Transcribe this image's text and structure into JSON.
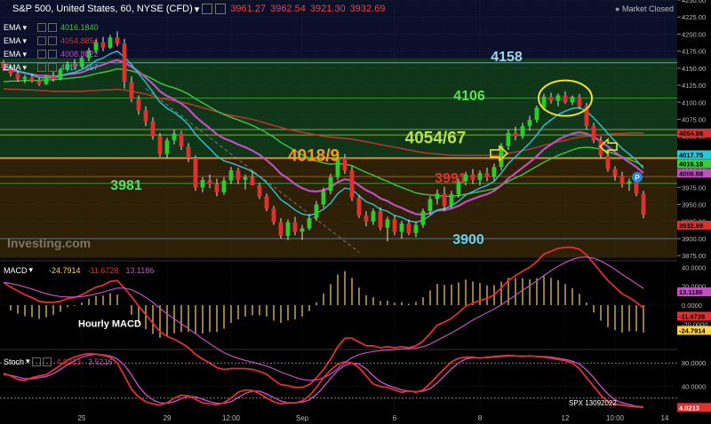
{
  "header": {
    "title": "S&P 500, United States, 60, NYSE (CFD)",
    "ohlc": [
      "3961.27",
      "3962.54",
      "3921.30",
      "3932.69"
    ],
    "status": "Market Closed"
  },
  "ema_legend": [
    {
      "name": "EMA",
      "value": "4016.1840",
      "color": "#3ec83e"
    },
    {
      "name": "EMA",
      "value": "4054.8854",
      "color": "#d23030"
    },
    {
      "name": "EMA",
      "value": "4008.8822",
      "color": "#c050c0"
    },
    {
      "name": "EMA",
      "value": "4017.7467",
      "color": "#29c7d6"
    }
  ],
  "macd_legend": {
    "name": "MACD",
    "values": [
      "-24.7914",
      "-11.6728",
      "13.1186"
    ],
    "colors": [
      "#ffd24a",
      "#e03030",
      "#c050c0"
    ]
  },
  "stoch_legend": {
    "name": "Stoch",
    "values": [
      "4.0213",
      "3.5216"
    ],
    "colors": [
      "#e03030",
      "#c050c0"
    ]
  },
  "watermark": "Investing.com",
  "colors": {
    "up": "#2dcc2d",
    "down": "#e03030",
    "ema_fast": "#29c7d6",
    "ema_mid": "#c050c0",
    "ema_slow": "#3ec83e",
    "ema_long": "#d23030",
    "zone": "#f39c1f",
    "circle": "#f0e020",
    "macd_hist": "#ffd24a",
    "stoch_k": "#e03030",
    "stoch_d": "#c050c0"
  },
  "chart_data": [
    {
      "type": "candlestick",
      "title": "S&P 500, United States, 60, NYSE (CFD)",
      "ylim": [
        3870,
        4250
      ],
      "y_ticks": [
        "3875.00",
        "3900.00",
        "3925.00",
        "3950.00",
        "3975.00",
        "4000.00",
        "4025.00",
        "4050.00",
        "4075.00",
        "4100.00",
        "4125.00",
        "4150.00",
        "4175.00",
        "4200.00",
        "4225.00",
        "4250.00"
      ],
      "x_ticks": [
        {
          "i": 11,
          "label": "25"
        },
        {
          "i": 23,
          "label": "29"
        },
        {
          "i": 32,
          "label": "12:00"
        },
        {
          "i": 42,
          "label": "Sep"
        },
        {
          "i": 55,
          "label": "6"
        },
        {
          "i": 67,
          "label": "8"
        },
        {
          "i": 79,
          "label": "12"
        },
        {
          "i": 86,
          "label": "10:00"
        },
        {
          "i": 93,
          "label": "14"
        }
      ],
      "candles": [
        [
          4158,
          4162,
          4146,
          4150
        ],
        [
          4150,
          4155,
          4138,
          4142
        ],
        [
          4142,
          4147,
          4130,
          4134
        ],
        [
          4134,
          4140,
          4128,
          4137
        ],
        [
          4137,
          4142,
          4129,
          4132
        ],
        [
          4132,
          4136,
          4124,
          4127
        ],
        [
          4127,
          4140,
          4125,
          4138
        ],
        [
          4138,
          4146,
          4130,
          4134
        ],
        [
          4134,
          4150,
          4132,
          4148
        ],
        [
          4148,
          4160,
          4145,
          4156
        ],
        [
          4156,
          4163,
          4148,
          4152
        ],
        [
          4152,
          4168,
          4150,
          4165
        ],
        [
          4165,
          4180,
          4160,
          4176
        ],
        [
          4176,
          4192,
          4172,
          4188
        ],
        [
          4188,
          4196,
          4175,
          4180
        ],
        [
          4180,
          4199,
          4178,
          4195
        ],
        [
          4195,
          4204,
          4182,
          4186
        ],
        [
          4186,
          4193,
          4120,
          4130
        ],
        [
          4130,
          4138,
          4100,
          4105
        ],
        [
          4105,
          4110,
          4082,
          4088
        ],
        [
          4088,
          4094,
          4065,
          4072
        ],
        [
          4072,
          4078,
          4045,
          4050
        ],
        [
          4050,
          4055,
          4020,
          4024
        ],
        [
          4024,
          4048,
          4018,
          4044
        ],
        [
          4044,
          4060,
          4038,
          4054
        ],
        [
          4054,
          4058,
          4030,
          4035
        ],
        [
          4035,
          4040,
          4012,
          4018
        ],
        [
          4018,
          4022,
          3970,
          3975
        ],
        [
          3975,
          3990,
          3968,
          3986
        ],
        [
          3986,
          3994,
          3974,
          3980
        ],
        [
          3980,
          3988,
          3962,
          3968
        ],
        [
          3968,
          3990,
          3964,
          3985
        ],
        [
          3985,
          4005,
          3980,
          4000
        ],
        [
          4000,
          4004,
          3980,
          3986
        ],
        [
          3986,
          3994,
          3972,
          3990
        ],
        [
          3990,
          4000,
          3980,
          3978
        ],
        [
          3978,
          3982,
          3958,
          3962
        ],
        [
          3962,
          3966,
          3940,
          3944
        ],
        [
          3944,
          3948,
          3920,
          3924
        ],
        [
          3924,
          3930,
          3900,
          3904
        ],
        [
          3904,
          3928,
          3898,
          3924
        ],
        [
          3924,
          3932,
          3905,
          3910
        ],
        [
          3910,
          3920,
          3898,
          3915
        ],
        [
          3915,
          3935,
          3912,
          3930
        ],
        [
          3930,
          3955,
          3926,
          3950
        ],
        [
          3950,
          3975,
          3945,
          3970
        ],
        [
          3970,
          3995,
          3965,
          3990
        ],
        [
          3990,
          4022,
          3986,
          4018
        ],
        [
          4018,
          4024,
          3995,
          4000
        ],
        [
          4000,
          4006,
          3955,
          3960
        ],
        [
          3960,
          3964,
          3930,
          3934
        ],
        [
          3934,
          3940,
          3918,
          3925
        ],
        [
          3925,
          3944,
          3920,
          3940
        ],
        [
          3940,
          3946,
          3912,
          3916
        ],
        [
          3916,
          3932,
          3896,
          3928
        ],
        [
          3928,
          3934,
          3905,
          3910
        ],
        [
          3910,
          3926,
          3900,
          3922
        ],
        [
          3922,
          3928,
          3905,
          3908
        ],
        [
          3908,
          3924,
          3902,
          3920
        ],
        [
          3920,
          3944,
          3916,
          3940
        ],
        [
          3940,
          3962,
          3936,
          3958
        ],
        [
          3958,
          3972,
          3950,
          3966
        ],
        [
          3966,
          3976,
          3940,
          3948
        ],
        [
          3948,
          3970,
          3945,
          3965
        ],
        [
          3965,
          3988,
          3960,
          3984
        ],
        [
          3984,
          3998,
          3978,
          3994
        ],
        [
          3994,
          4002,
          3980,
          3986
        ],
        [
          3986,
          4000,
          3978,
          3996
        ],
        [
          3996,
          4004,
          3984,
          3990
        ],
        [
          3990,
          4010,
          3985,
          4005
        ],
        [
          4005,
          4040,
          4000,
          4036
        ],
        [
          4036,
          4060,
          4030,
          4055
        ],
        [
          4055,
          4064,
          4044,
          4050
        ],
        [
          4050,
          4070,
          4046,
          4065
        ],
        [
          4065,
          4080,
          4058,
          4074
        ],
        [
          4074,
          4095,
          4070,
          4092
        ],
        [
          4092,
          4112,
          4088,
          4108
        ],
        [
          4108,
          4114,
          4098,
          4102
        ],
        [
          4102,
          4113,
          4094,
          4110
        ],
        [
          4110,
          4116,
          4098,
          4100
        ],
        [
          4100,
          4110,
          4096,
          4108
        ],
        [
          4108,
          4112,
          4090,
          4094
        ],
        [
          4094,
          4099,
          4060,
          4065
        ],
        [
          4065,
          4070,
          4040,
          4044
        ],
        [
          4044,
          4050,
          4018,
          4022
        ],
        [
          4022,
          4026,
          3998,
          4002
        ],
        [
          4002,
          4006,
          3985,
          3992
        ],
        [
          3992,
          3998,
          3975,
          3980
        ],
        [
          3980,
          3988,
          3970,
          3984
        ],
        [
          3984,
          3990,
          3962,
          3966
        ],
        [
          3966,
          3970,
          3930,
          3935
        ]
      ],
      "ema_fast": [
        4154,
        4150,
        4146,
        4143,
        4140,
        4136,
        4136,
        4136,
        4138,
        4142,
        4144,
        4148,
        4154,
        4161,
        4165,
        4171,
        4175,
        4166,
        4155,
        4142,
        4129,
        4115,
        4100,
        4091,
        4085,
        4077,
        4067,
        4053,
        4042,
        4032,
        4021,
        4014,
        4011,
        4007,
        4003,
        3998,
        3991,
        3982,
        3970,
        3957,
        3950,
        3942,
        3936,
        3934,
        3937,
        3943,
        3952,
        3966,
        3974,
        3972,
        3963,
        3954,
        3950,
        3943,
        3940,
        3934,
        3931,
        3926,
        3924,
        3927,
        3934,
        3942,
        3944,
        3948,
        3955,
        3964,
        3969,
        3974,
        3978,
        3984,
        3996,
        4010,
        4020,
        4030,
        4040,
        4052,
        4066,
        4074,
        4082,
        4087,
        4091,
        4092,
        4087,
        4077,
        4066,
        4054,
        4043,
        4032,
        4024,
        4015,
        4003
      ],
      "ema_mid": [
        4148,
        4147,
        4145,
        4143,
        4141,
        4139,
        4139,
        4138,
        4139,
        4141,
        4142,
        4144,
        4148,
        4152,
        4155,
        4159,
        4162,
        4158,
        4152,
        4145,
        4136,
        4127,
        4116,
        4109,
        4104,
        4098,
        4090,
        4079,
        4070,
        4062,
        4053,
        4047,
        4043,
        4038,
        4034,
        4029,
        4023,
        4015,
        4006,
        3995,
        3988,
        3980,
        3974,
        3970,
        3969,
        3971,
        3975,
        3983,
        3987,
        3985,
        3978,
        3971,
        3966,
        3959,
        3955,
        3949,
        3945,
        3940,
        3936,
        3935,
        3937,
        3941,
        3942,
        3944,
        3948,
        3954,
        3958,
        3962,
        3965,
        3970,
        3978,
        3988,
        3996,
        4004,
        4012,
        4021,
        4031,
        4038,
        4045,
        4050,
        4054,
        4056,
        4054,
        4049,
        4043,
        4035,
        4027,
        4019,
        4012,
        4005,
        3996
      ],
      "ema_slow": [
        4130,
        4131,
        4131,
        4132,
        4132,
        4132,
        4133,
        4133,
        4134,
        4135,
        4136,
        4137,
        4139,
        4142,
        4144,
        4146,
        4149,
        4148,
        4146,
        4143,
        4139,
        4134,
        4128,
        4124,
        4121,
        4117,
        4112,
        4105,
        4099,
        4093,
        4087,
        4082,
        4078,
        4074,
        4070,
        4066,
        4061,
        4055,
        4049,
        4041,
        4035,
        4029,
        4023,
        4018,
        4014,
        4011,
        4009,
        4010,
        4009,
        4007,
        4002,
        3997,
        3993,
        3988,
        3984,
        3979,
        3975,
        3971,
        3967,
        3965,
        3964,
        3963,
        3962,
        3962,
        3963,
        3965,
        3967,
        3969,
        3971,
        3973,
        3978,
        3984,
        3989,
        3994,
        4000,
        4006,
        4012,
        4017,
        4022,
        4026,
        4030,
        4033,
        4034,
        4033,
        4031,
        4028,
        4024,
        4020,
        4016,
        4012,
        4006
      ],
      "ema_long": [
        4120,
        4119,
        4119,
        4118,
        4118,
        4117,
        4117,
        4116,
        4116,
        4116,
        4116,
        4116,
        4117,
        4117,
        4118,
        4118,
        4119,
        4118,
        4116,
        4114,
        4112,
        4109,
        4106,
        4104,
        4102,
        4100,
        4098,
        4095,
        4092,
        4089,
        4086,
        4083,
        4081,
        4079,
        4077,
        4075,
        4072,
        4069,
        4066,
        4063,
        4060,
        4058,
        4056,
        4054,
        4052,
        4050,
        4049,
        4048,
        4047,
        4046,
        4044,
        4042,
        4040,
        4038,
        4036,
        4034,
        4032,
        4030,
        4028,
        4026,
        4025,
        4024,
        4023,
        4022,
        4022,
        4022,
        4022,
        4022,
        4022,
        4022,
        4023,
        4025,
        4027,
        4029,
        4031,
        4034,
        4037,
        4039,
        4042,
        4044,
        4047,
        4049,
        4050,
        4051,
        4052,
        4053,
        4054,
        4054,
        4055,
        4055,
        4055
      ],
      "levels": [
        {
          "value": 4158,
          "label": "4158",
          "color": "#9fd4f0"
        },
        {
          "value": 4106,
          "label": "4106",
          "color": "#55e055"
        },
        {
          "value": 4054,
          "label": "4054/67",
          "color": "#b8e04a"
        },
        {
          "value": 4018,
          "label": "4018/9",
          "color": "#f39c1f"
        },
        {
          "value": 3991,
          "label": "3991",
          "color": "#e03030"
        },
        {
          "value": 3981,
          "label": "3981",
          "color": "#55e055"
        },
        {
          "value": 3900,
          "label": "3900",
          "color": "#5fd5f0"
        }
      ],
      "price_tags": [
        {
          "value": 4054.88,
          "label": "4054.88",
          "color": "#d23030"
        },
        {
          "value": 4017.75,
          "label": "4017.75",
          "color": "#29c7d6"
        },
        {
          "value": 4016.18,
          "label": "4016.18",
          "color": "#3ec83e"
        },
        {
          "value": 4008.88,
          "label": "4008.88",
          "color": "#c050c0"
        },
        {
          "value": 3932.69,
          "label": "3932.69",
          "color": "#e03030"
        }
      ]
    },
    {
      "type": "bar",
      "title": "Hourly MACD",
      "ylim": [
        -45,
        45
      ],
      "y_ticks": [
        "40.0000",
        "20.0000",
        "0.0000",
        "-20.0000"
      ],
      "price_tags": [
        {
          "value": 13.1186,
          "label": "13.1186",
          "color": "#c050c0"
        },
        {
          "value": -11.6728,
          "label": "-11.6728",
          "color": "#e03030"
        },
        {
          "value": -24.7914,
          "label": "-24.7914",
          "color": "#ffd24a"
        }
      ]
    },
    {
      "type": "line",
      "title": "Stoch",
      "ylim": [
        0,
        100
      ],
      "y_ticks": [
        "80.0000",
        "40.0000"
      ],
      "annotation": "SPX 13092022",
      "k": [
        62,
        58,
        52,
        50,
        55,
        58,
        60,
        68,
        76,
        85,
        90,
        94,
        96,
        95,
        93,
        90,
        80,
        58,
        35,
        22,
        14,
        10,
        8,
        12,
        20,
        25,
        24,
        18,
        12,
        10,
        9,
        12,
        20,
        30,
        34,
        33,
        28,
        20,
        14,
        10,
        12,
        12,
        15,
        24,
        38,
        55,
        68,
        78,
        82,
        80,
        72,
        58,
        44,
        40,
        38,
        34,
        30,
        32,
        30,
        34,
        45,
        58,
        70,
        82,
        88,
        90,
        90,
        88,
        90,
        91,
        92,
        93,
        92,
        91,
        92,
        91,
        90,
        88,
        86,
        84,
        80,
        70,
        55,
        40,
        25,
        14,
        10,
        8,
        6,
        5,
        4
      ],
      "d": [
        60,
        59,
        56,
        53,
        53,
        55,
        57,
        62,
        69,
        77,
        84,
        90,
        93,
        95,
        94,
        92,
        87,
        76,
        60,
        40,
        26,
        17,
        12,
        11,
        14,
        19,
        23,
        22,
        18,
        14,
        11,
        11,
        14,
        21,
        28,
        32,
        32,
        27,
        21,
        15,
        12,
        12,
        13,
        17,
        26,
        39,
        54,
        67,
        76,
        80,
        78,
        70,
        58,
        48,
        42,
        38,
        34,
        32,
        31,
        32,
        36,
        46,
        58,
        70,
        80,
        87,
        89,
        89,
        89,
        90,
        91,
        92,
        92,
        92,
        92,
        91,
        91,
        90,
        88,
        86,
        83,
        78,
        68,
        55,
        40,
        27,
        17,
        12,
        9,
        6,
        5
      ]
    }
  ]
}
